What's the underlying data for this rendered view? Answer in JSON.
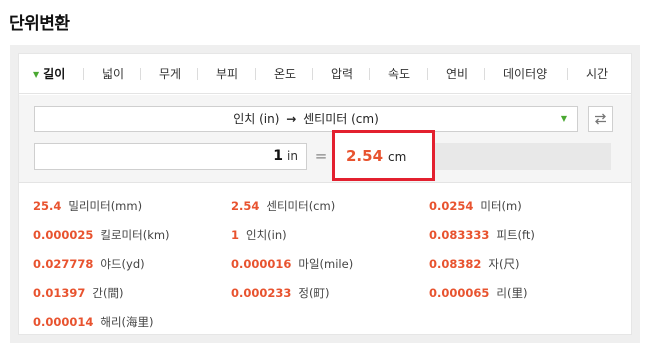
{
  "title": "단위변환",
  "tabs": [
    "길이",
    "넓이",
    "무게",
    "부피",
    "온도",
    "압력",
    "속도",
    "연비",
    "데이터양",
    "시간"
  ],
  "selector": {
    "from": "인치 (in)",
    "arrow": "→",
    "to": "센티미터 (cm)"
  },
  "input": {
    "value": "1",
    "unit": "in"
  },
  "equals": "=",
  "result": {
    "value": "2.54",
    "unit": "cm"
  },
  "results": [
    {
      "value": "25.4",
      "name": "밀리미터(mm)"
    },
    {
      "value": "2.54",
      "name": "센티미터(cm)"
    },
    {
      "value": "0.0254",
      "name": "미터(m)"
    },
    {
      "value": "0.000025",
      "name": "킬로미터(km)"
    },
    {
      "value": "1",
      "name": "인치(in)"
    },
    {
      "value": "0.083333",
      "name": "피트(ft)"
    },
    {
      "value": "0.027778",
      "name": "야드(yd)"
    },
    {
      "value": "0.000016",
      "name": "마일(mile)"
    },
    {
      "value": "0.08382",
      "name": "자(尺)"
    },
    {
      "value": "0.01397",
      "name": "간(間)"
    },
    {
      "value": "0.000233",
      "name": "정(町)"
    },
    {
      "value": "0.000065",
      "name": "리(里)"
    },
    {
      "value": "0.000014",
      "name": "해리(海里)"
    }
  ],
  "icons": {
    "tab_caret": "caret-down-icon",
    "dropdown": "dropdown-arrow-icon",
    "swap": "swap-arrows-icon"
  },
  "colors": {
    "accent_green": "#4aa832",
    "value_orange": "#e8532f",
    "highlight_red": "#e3202f"
  }
}
